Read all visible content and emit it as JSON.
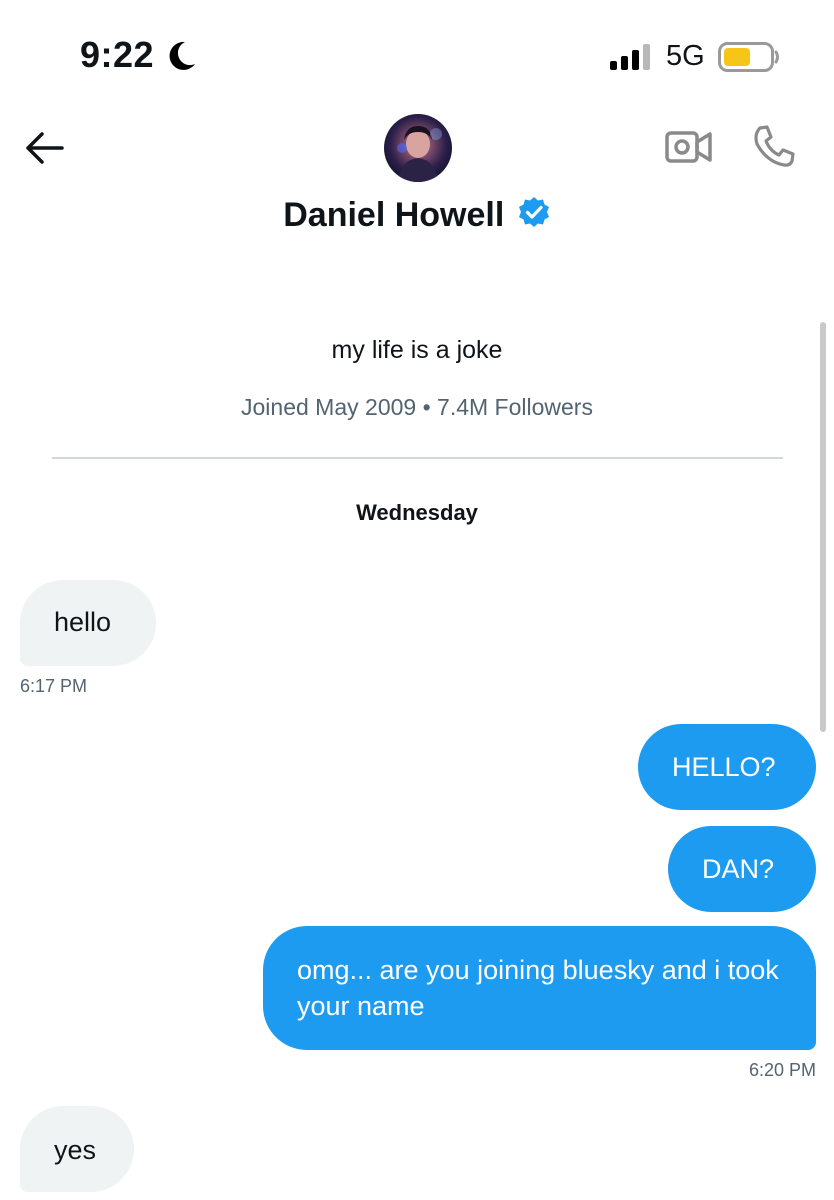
{
  "status_bar": {
    "time": "9:22",
    "network": "5G"
  },
  "header": {
    "name": "Daniel Howell",
    "icons": [
      "back-arrow-icon",
      "video-camera-icon",
      "phone-icon",
      "verified-badge-icon"
    ]
  },
  "profile": {
    "bio": "my life is a joke",
    "meta": "Joined May 2009 • 7.4M Followers"
  },
  "conversation": {
    "day_separator": "Wednesday",
    "messages": [
      {
        "direction": "incoming",
        "text": "hello"
      },
      {
        "direction": "outgoing",
        "text": "HELLO?"
      },
      {
        "direction": "outgoing",
        "text": "DAN?"
      },
      {
        "direction": "outgoing",
        "text": "omg... are you joining bluesky and i took your name"
      },
      {
        "direction": "incoming",
        "text": "yes"
      }
    ],
    "timestamps": [
      "6:17 PM",
      "6:20 PM"
    ]
  },
  "colors": {
    "accent": "#1d9bf0",
    "incoming_bubble": "#eff3f4",
    "secondary_text": "#536471",
    "battery_fill": "#f5c518"
  }
}
